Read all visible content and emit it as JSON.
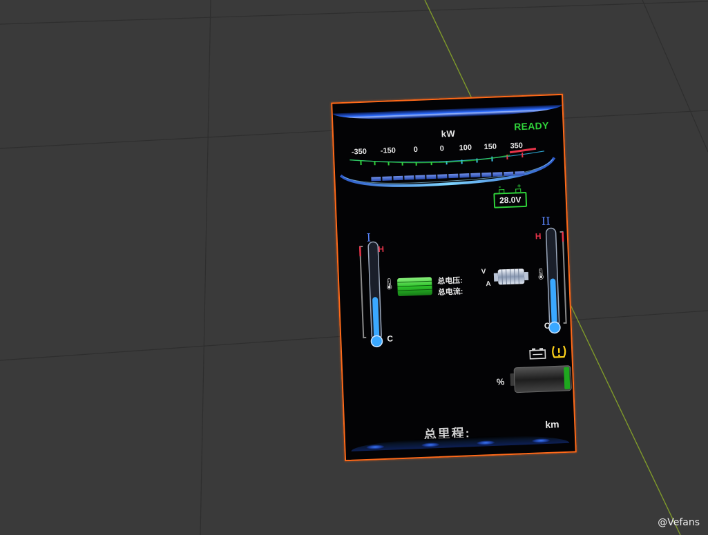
{
  "dashboard": {
    "power_unit": "kW",
    "status": "READY",
    "scale_ticks": [
      "-350",
      "-150",
      "0",
      "0",
      "100",
      "150",
      "350"
    ],
    "power_level_percent": 0,
    "aux_battery": {
      "minus": "-",
      "plus": "+",
      "voltage": "28.0V"
    },
    "left_temp": {
      "numeral": "I",
      "high": "H",
      "low": "C",
      "level_percent": 45
    },
    "right_temp": {
      "numeral": "II",
      "high": "H",
      "low": "C",
      "level_percent": 50
    },
    "pack": {
      "total_voltage_label": "总电压:",
      "total_current_label": "总电流:"
    },
    "motor": {
      "voltage_unit": "V",
      "current_unit": "A"
    },
    "soc": {
      "unit": "%"
    },
    "odometer": {
      "label": "总里程:",
      "unit": "km"
    },
    "colors": {
      "frame": "#ff6a1a",
      "ready": "#2fd13a",
      "hot": "#e8344a",
      "coolant": "#3aa8ff",
      "warning": "#ffd21a"
    },
    "icons": [
      "coolant-temp-icon",
      "battery-pack-icon",
      "motor-icon",
      "battery-service-icon",
      "tire-pressure-warning-icon"
    ]
  },
  "viewport": {
    "watermark": "@Vefans"
  }
}
